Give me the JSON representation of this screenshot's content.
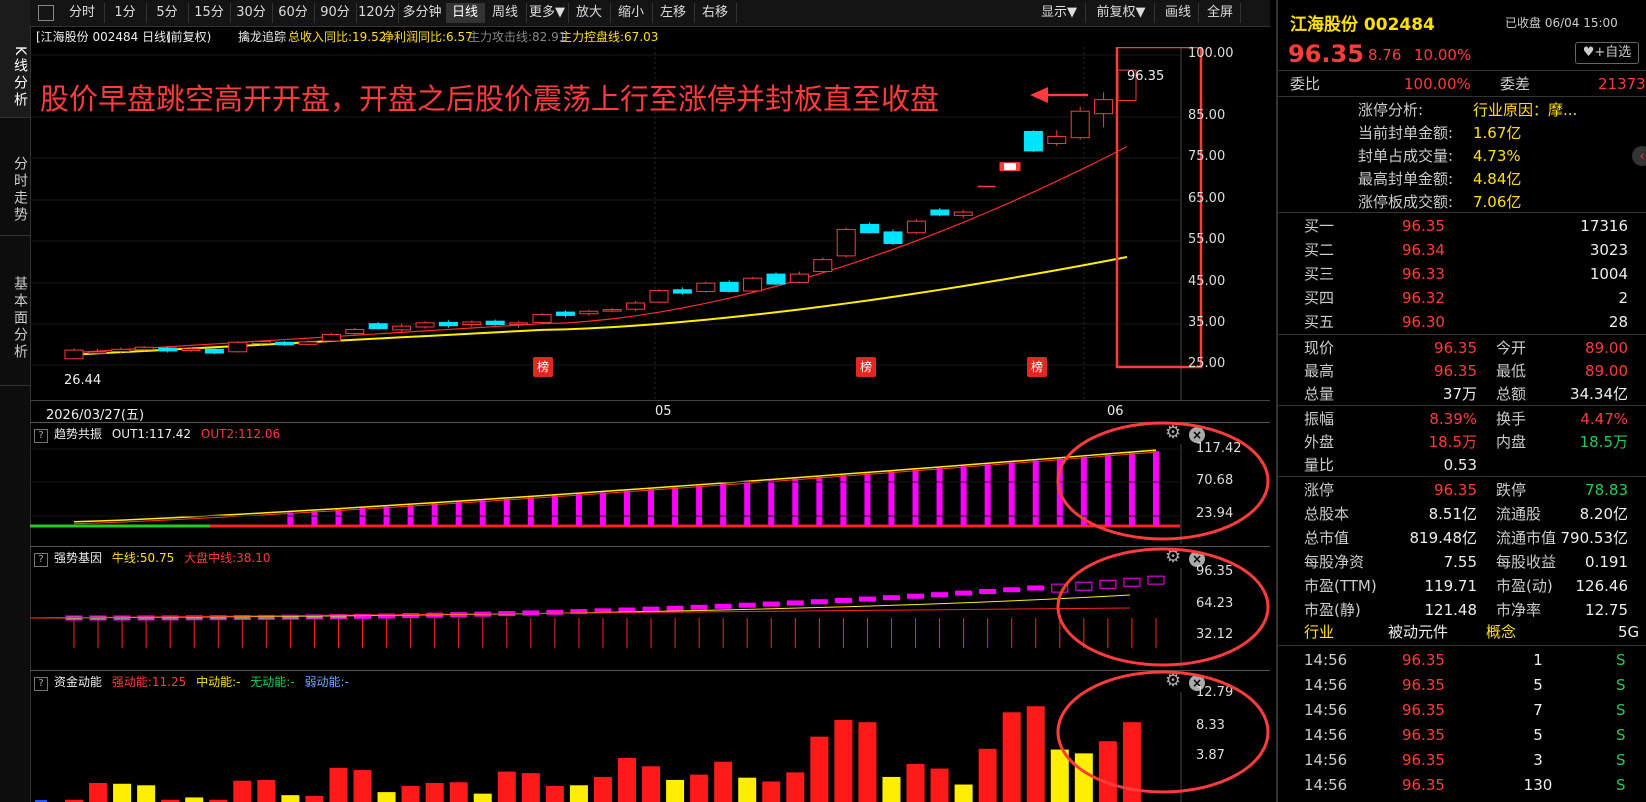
{
  "left_tabs": [
    "K线分析",
    "分时走势",
    "基本面分析"
  ],
  "toolbar": {
    "periods": [
      "分时",
      "1分",
      "5分",
      "15分",
      "30分",
      "60分",
      "90分",
      "120分",
      "多分钟",
      "日线",
      "周线",
      "更多▼",
      "放大",
      "缩小",
      "左移",
      "右移"
    ],
    "active": "日线",
    "right": [
      "显示▼",
      "前复权▼",
      "画线",
      "全屏"
    ]
  },
  "info": {
    "stock": "[江海股份 002484 日线]",
    "adjust": "(前复权)",
    "indicator": "擒龙追踪",
    "rev": "总收入同比:19.52",
    "profit": "净利润同比:6.57",
    "attack": "主力攻击线:82.91",
    "control": "主力控盘线:67.03"
  },
  "annotation": "股价早盘跳空高开开盘，开盘之后股价震荡上行至涨停并封板直至收盘",
  "main_chart": {
    "y_ticks": [
      "100.00",
      "85.00",
      "75.00",
      "65.00",
      "55.00",
      "45.00",
      "35.00",
      "25.00"
    ],
    "x_labels": [
      "2026/03/27(五)",
      "05",
      "06"
    ],
    "low_label": "26.44",
    "high_label": "96.35",
    "bang_label": "榜"
  },
  "panel1": {
    "name": "趋势共振",
    "out1": "OUT1:117.42",
    "out2": "OUT2:112.06",
    "y_ticks": [
      "117.42",
      "70.68",
      "23.94"
    ]
  },
  "panel2": {
    "name": "强势基因",
    "bull": "牛线:50.75",
    "market": "大盘中线:38.10",
    "y_ticks": [
      "96.35",
      "64.23",
      "32.12"
    ]
  },
  "panel3": {
    "name": "资金动能",
    "strong": "强动能:11.25",
    "mid": "中动能:-",
    "none": "无动能:-",
    "weak": "弱动能:-",
    "y_ticks": [
      "12.79",
      "8.33",
      "3.87"
    ]
  },
  "quote": {
    "name": "江海股份 002484",
    "status": "已收盘 06/04 15:00",
    "price": "96.35",
    "change": "8.76",
    "pct": "10.00%",
    "watch": "+自选",
    "weibi_label": "委比",
    "weibi": "100.00%",
    "weicha_label": "委差",
    "weicha": "21373",
    "limit_items": [
      {
        "label": "涨停分析:",
        "value": "行业原因：摩..."
      },
      {
        "label": "当前封单金额:",
        "value": "1.67亿"
      },
      {
        "label": "封单占成交量:",
        "value": "4.73%"
      },
      {
        "label": "最高封单金额:",
        "value": "4.84亿"
      },
      {
        "label": "涨停板成交额:",
        "value": "7.06亿"
      }
    ],
    "bids": [
      {
        "label": "买一",
        "price": "96.35",
        "vol": "17316"
      },
      {
        "label": "买二",
        "price": "96.34",
        "vol": "3023"
      },
      {
        "label": "买三",
        "price": "96.33",
        "vol": "1004"
      },
      {
        "label": "买四",
        "price": "96.32",
        "vol": "2"
      },
      {
        "label": "买五",
        "price": "96.30",
        "vol": "28"
      }
    ],
    "stats1": [
      [
        "现价",
        "96.35",
        "今开",
        "89.00"
      ],
      [
        "最高",
        "96.35",
        "最低",
        "89.00"
      ],
      [
        "总量",
        "37万",
        "总额",
        "34.34亿"
      ]
    ],
    "stats2": [
      [
        "振幅",
        "8.39%",
        "换手",
        "4.47%"
      ],
      [
        "外盘",
        "18.5万",
        "内盘",
        "18.5万"
      ],
      [
        "量比",
        "0.53",
        "",
        ""
      ]
    ],
    "stats3": [
      [
        "涨停",
        "96.35",
        "跌停",
        "78.83"
      ],
      [
        "总股本",
        "8.51亿",
        "流通股",
        "8.20亿"
      ],
      [
        "总市值",
        "819.48亿",
        "流通市值",
        "790.53亿"
      ],
      [
        "每股净资",
        "7.55",
        "每股收益",
        "0.191"
      ],
      [
        "市盈(TTM)",
        "119.71",
        "市盈(动)",
        "126.46"
      ],
      [
        "市盈(静)",
        "121.48",
        "市净率",
        "12.75"
      ]
    ],
    "industry_label": "行业",
    "industry": "被动元件",
    "concept_label": "概念",
    "concept": "5G",
    "ticks": [
      {
        "time": "14:56",
        "price": "96.35",
        "vol": "1",
        "bs": "S"
      },
      {
        "time": "14:56",
        "price": "96.35",
        "vol": "5",
        "bs": "S"
      },
      {
        "time": "14:56",
        "price": "96.35",
        "vol": "7",
        "bs": "S"
      },
      {
        "time": "14:56",
        "price": "96.35",
        "vol": "5",
        "bs": "S"
      },
      {
        "time": "14:56",
        "price": "96.35",
        "vol": "3",
        "bs": "S"
      },
      {
        "time": "14:56",
        "price": "96.35",
        "vol": "130",
        "bs": "S"
      }
    ]
  },
  "colors": {
    "up": "#ff3b3b",
    "down": "#00e5ff",
    "ma1": "#ff2a2a",
    "ma2": "#ffee00",
    "magenta": "#ff00ff"
  }
}
